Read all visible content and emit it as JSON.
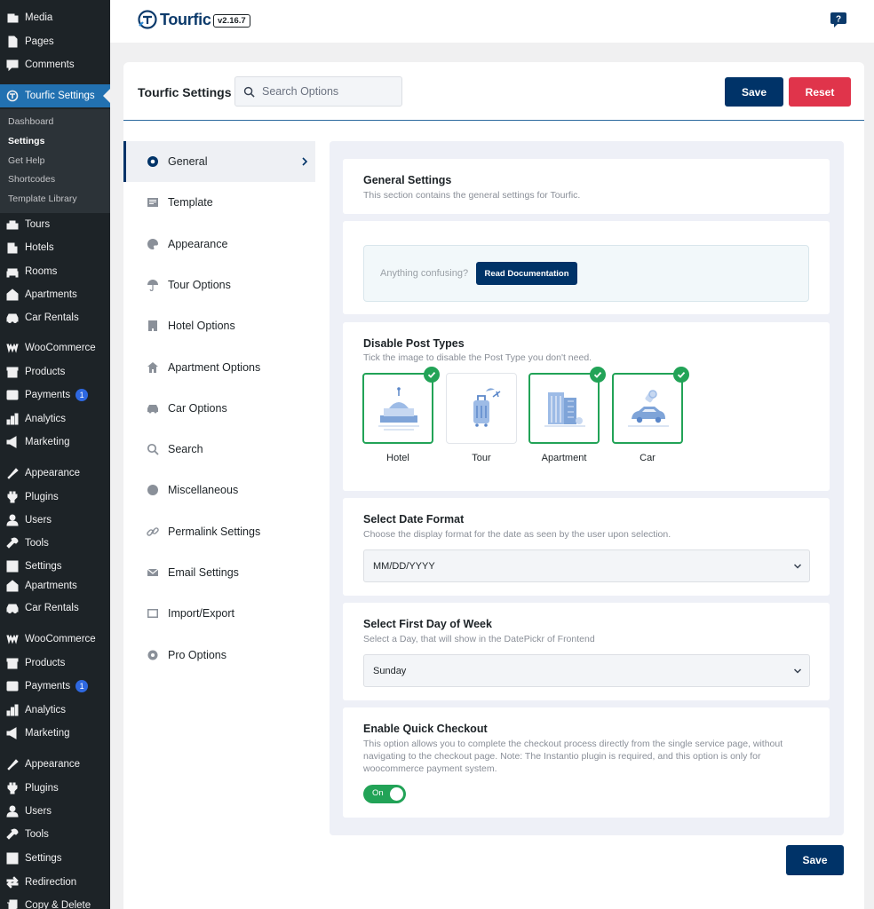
{
  "wp_sidebar": {
    "items": [
      {
        "label": "Media",
        "icon": "media-icon"
      },
      {
        "label": "Pages",
        "icon": "pages-icon"
      },
      {
        "label": "Comments",
        "icon": "comments-icon"
      },
      {
        "label": "Tourfic Settings",
        "icon": "tourfic-icon"
      },
      {
        "label": "Tours",
        "icon": "tours-icon"
      },
      {
        "label": "Hotels",
        "icon": "hotels-icon"
      },
      {
        "label": "Rooms",
        "icon": "rooms-icon"
      },
      {
        "label": "Apartments",
        "icon": "apartments-icon"
      },
      {
        "label": "Car Rentals",
        "icon": "car-icon"
      },
      {
        "label": "WooCommerce",
        "icon": "woocommerce-icon"
      },
      {
        "label": "Products",
        "icon": "products-icon"
      },
      {
        "label": "Payments",
        "icon": "payments-icon",
        "badge": "1"
      },
      {
        "label": "Analytics",
        "icon": "analytics-icon"
      },
      {
        "label": "Marketing",
        "icon": "marketing-icon"
      },
      {
        "label": "Appearance",
        "icon": "appearance-icon"
      },
      {
        "label": "Plugins",
        "icon": "plugins-icon"
      },
      {
        "label": "Users",
        "icon": "users-icon"
      },
      {
        "label": "Tools",
        "icon": "tools-icon"
      },
      {
        "label": "Settings",
        "icon": "settings-icon"
      },
      {
        "label": "Apartments",
        "icon": "apartments-icon"
      },
      {
        "label": "Car Rentals",
        "icon": "car-icon"
      },
      {
        "label": "WooCommerce",
        "icon": "woocommerce-icon"
      },
      {
        "label": "Products",
        "icon": "products-icon"
      },
      {
        "label": "Payments",
        "icon": "payments-icon",
        "badge": "1"
      },
      {
        "label": "Analytics",
        "icon": "analytics-icon"
      },
      {
        "label": "Marketing",
        "icon": "marketing-icon"
      },
      {
        "label": "Appearance",
        "icon": "appearance-icon"
      },
      {
        "label": "Plugins",
        "icon": "plugins-icon"
      },
      {
        "label": "Users",
        "icon": "users-icon"
      },
      {
        "label": "Tools",
        "icon": "tools-icon"
      },
      {
        "label": "Settings",
        "icon": "settings-icon"
      },
      {
        "label": "Redirection",
        "icon": "redirection-icon"
      },
      {
        "label": "Copy & Delete",
        "icon": "copy-icon"
      }
    ],
    "submenu": [
      "Dashboard",
      "Settings",
      "Get Help",
      "Shortcodes",
      "Template Library"
    ],
    "active_item": "Tourfic Settings",
    "current_submenu": "Settings"
  },
  "topbar": {
    "brand": "Tourfic",
    "version": "v2.16.7"
  },
  "header": {
    "title": "Tourfic Settings",
    "search_placeholder": "Search Options",
    "save_label": "Save",
    "reset_label": "Reset"
  },
  "nav": {
    "items": [
      {
        "label": "General",
        "icon": "gear-icon"
      },
      {
        "label": "Template",
        "icon": "template-icon"
      },
      {
        "label": "Appearance",
        "icon": "palette-icon"
      },
      {
        "label": "Tour Options",
        "icon": "umbrella-icon"
      },
      {
        "label": "Hotel Options",
        "icon": "building-icon"
      },
      {
        "label": "Apartment Options",
        "icon": "home-icon"
      },
      {
        "label": "Car Options",
        "icon": "car-icon"
      },
      {
        "label": "Search",
        "icon": "search-icon"
      },
      {
        "label": "Miscellaneous",
        "icon": "globe-icon"
      },
      {
        "label": "Permalink Settings",
        "icon": "link-icon"
      },
      {
        "label": "Email Settings",
        "icon": "envelope-icon"
      },
      {
        "label": "Import/Export",
        "icon": "import-export-icon"
      },
      {
        "label": "Pro Options",
        "icon": "cog-icon"
      }
    ],
    "active": "General"
  },
  "general": {
    "title": "General Settings",
    "description": "This section contains the general settings for Tourfic.",
    "doc_prompt": "Anything confusing?",
    "doc_button": "Read Documentation"
  },
  "post_types": {
    "title": "Disable Post Types",
    "description": "Tick the image to disable the Post Type you don't need.",
    "items": [
      {
        "label": "Hotel",
        "checked": true
      },
      {
        "label": "Tour",
        "checked": false
      },
      {
        "label": "Apartment",
        "checked": true
      },
      {
        "label": "Car",
        "checked": true
      }
    ]
  },
  "date_format": {
    "title": "Select Date Format",
    "description": "Choose the display format for the date as seen by the user upon selection.",
    "value": "MM/DD/YYYY"
  },
  "first_day": {
    "title": "Select First Day of Week",
    "description": "Select a Day, that will show in the DatePickr of Frontend",
    "value": "Sunday"
  },
  "quick_checkout": {
    "title": "Enable Quick Checkout",
    "description": "This option allows you to complete the checkout process directly from the single service page, without navigating to the checkout page. Note: The Instantio plugin is required, and this option is only for woocommerce payment system.",
    "toggle_label": "On",
    "enabled": true
  },
  "footer": {
    "save_label": "Save"
  },
  "colors": {
    "primary": "#003368",
    "danger": "#e0344b",
    "success": "#22a357",
    "wp_sidebar": "#1d2327",
    "wp_active": "#2271b1"
  }
}
